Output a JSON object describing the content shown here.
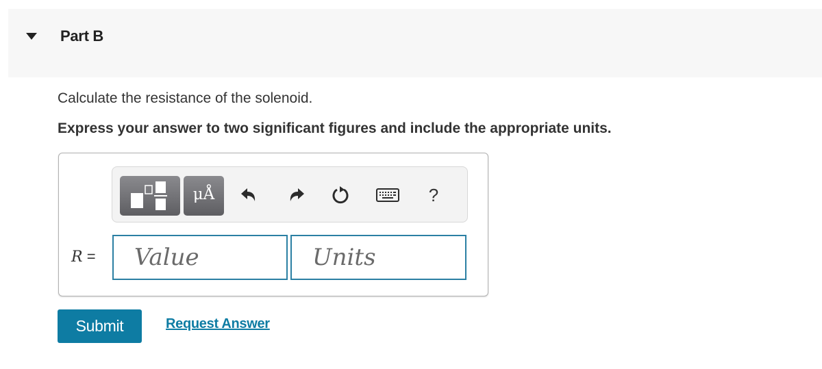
{
  "part": {
    "title": "Part B",
    "expanded": true
  },
  "question": {
    "text": "Calculate the resistance of the solenoid.",
    "instructions": "Express your answer to two significant figures and include the appropriate units."
  },
  "toolbar": {
    "buttons": [
      {
        "name": "templates",
        "icon": "fraction-template-icon"
      },
      {
        "name": "units",
        "label": "μÅ",
        "icon": "units-icon"
      },
      {
        "name": "undo",
        "icon": "undo-icon"
      },
      {
        "name": "redo",
        "icon": "redo-icon"
      },
      {
        "name": "reset",
        "icon": "reset-icon"
      },
      {
        "name": "keyboard",
        "icon": "keyboard-icon"
      },
      {
        "name": "help",
        "label": "?",
        "icon": "help-icon"
      }
    ]
  },
  "answer": {
    "variable": "R",
    "equals": "=",
    "value": "",
    "value_placeholder": "Value",
    "units": "",
    "units_placeholder": "Units"
  },
  "actions": {
    "submit_label": "Submit",
    "request_answer_label": "Request Answer"
  },
  "colors": {
    "accent": "#0e7ca3",
    "header_bg": "#f7f7f7",
    "toolbar_bg": "#f3f3f3"
  }
}
